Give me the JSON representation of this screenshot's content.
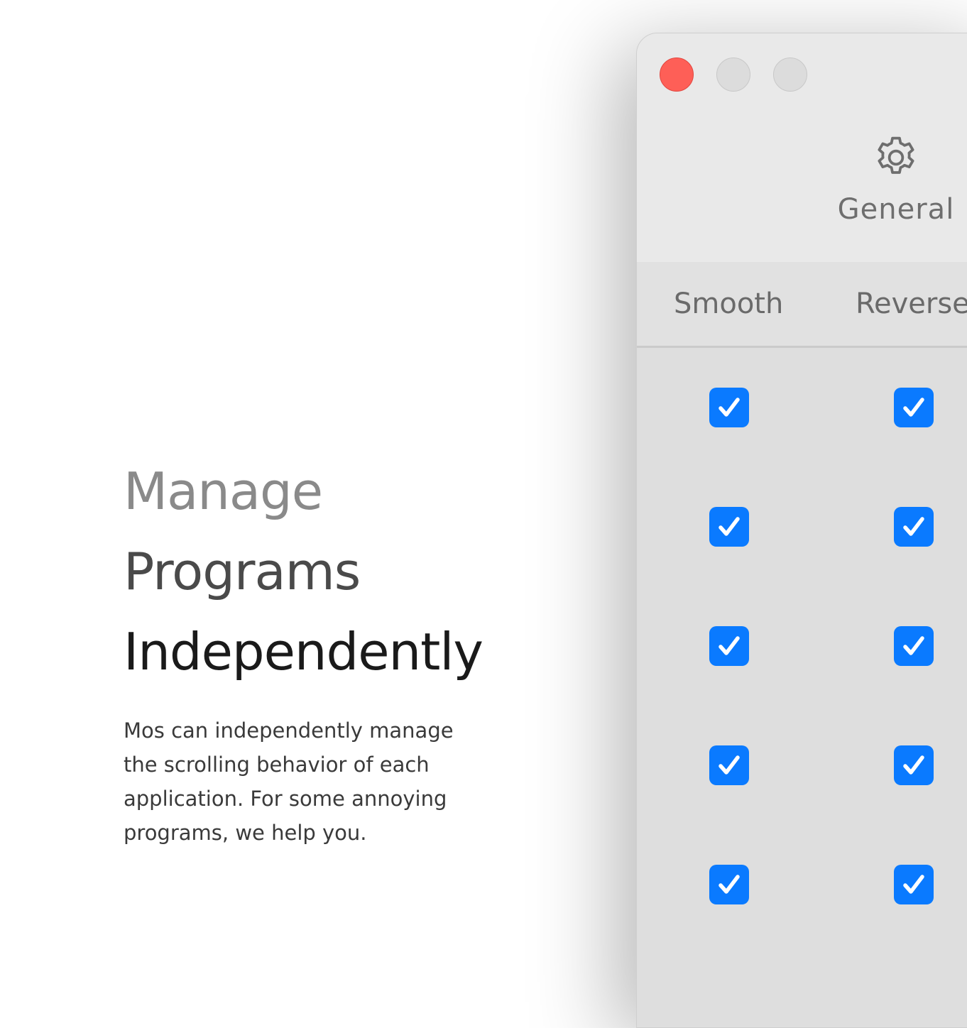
{
  "hero": {
    "line1": "Manage",
    "line2": "Programs",
    "line3": "Independently",
    "description": "Mos can independently manage the scrolling behavior of each application. For some annoying programs, we help you."
  },
  "window": {
    "toolbar": {
      "general_label": "General",
      "general_icon": "gear-icon"
    },
    "table": {
      "columns": [
        "Smooth",
        "Reverse"
      ],
      "rows": [
        {
          "smooth": true,
          "reverse": true
        },
        {
          "smooth": true,
          "reverse": true
        },
        {
          "smooth": true,
          "reverse": true
        },
        {
          "smooth": true,
          "reverse": true
        },
        {
          "smooth": true,
          "reverse": true
        }
      ]
    }
  },
  "colors": {
    "close_button": "#fe5f57",
    "checkbox_accent": "#0a7aff",
    "window_background": "#dedede"
  }
}
